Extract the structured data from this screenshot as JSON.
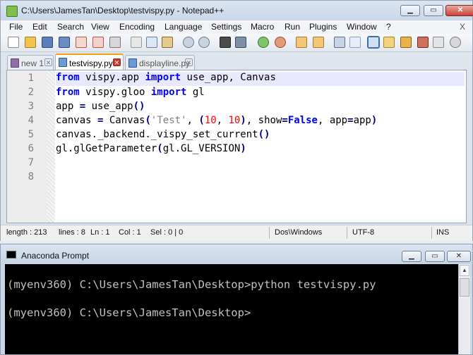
{
  "npp": {
    "title": "C:\\Users\\JamesTan\\Desktop\\testvispy.py - Notepad++",
    "menu": [
      "File",
      "Edit",
      "Search",
      "View",
      "Encoding",
      "Language",
      "Settings",
      "Macro",
      "Run",
      "Plugins",
      "Window",
      "?"
    ],
    "menu_close": "X",
    "tabs": [
      {
        "label": "new 1",
        "close": "✕"
      },
      {
        "label": "testvispy.py",
        "close": "✕"
      },
      {
        "label": "displayline.py",
        "close": "✕"
      }
    ],
    "line_numbers": [
      "1",
      "2",
      "3",
      "4",
      "5",
      "6",
      "7",
      "8"
    ],
    "code": {
      "l1": {
        "kw1": "from",
        "mod": " vispy.app ",
        "kw2": "import",
        "rest": " use_app, Canvas"
      },
      "l2": {
        "kw1": "from",
        "mod": " vispy.gloo ",
        "kw2": "import",
        "rest": " gl"
      },
      "l3": {
        "a": "app ",
        "eq": "=",
        "b": " use_app",
        "p": "()"
      },
      "l4": {
        "a": "canvas ",
        "eq": "=",
        "b": " Canvas",
        "p1": "(",
        "s": "'Test'",
        "c1": ", ",
        "p2": "(",
        "n1": "10",
        "c2": ", ",
        "n2": "10",
        "p3": ")",
        "c3": ", show",
        "eq2": "=",
        "f": "False",
        "c4": ", app",
        "eq3": "=",
        "d": "app",
        "p4": ")"
      },
      "l5": {
        "a": "canvas._backend._vispy_set_current",
        "p": "()"
      },
      "l6": {
        "a": "gl.glGetParameter",
        "p1": "(",
        "b": "gl.GL_VERSION",
        "p2": ")"
      }
    },
    "status": {
      "length": "length : 213",
      "lines": "lines : 8",
      "ln": "Ln : 1",
      "col": "Col : 1",
      "sel": "Sel : 0 | 0",
      "eol": "Dos\\Windows",
      "encoding": "UTF-8",
      "mode": "INS"
    }
  },
  "conda": {
    "title": "Anaconda Prompt",
    "lines": [
      "(myenv360) C:\\Users\\JamesTan\\Desktop>python testvispy.py",
      "(myenv360) C:\\Users\\JamesTan\\Desktop>"
    ]
  },
  "icons": {
    "titlebar": [
      "notepadpp-app-icon",
      "minimize-icon",
      "maximize-icon",
      "close-icon"
    ],
    "toolbar": [
      "new-file-icon",
      "open-file-icon",
      "save-icon",
      "save-all-icon",
      "close-icon",
      "close-all-icon",
      "print-icon",
      "cut-icon",
      "copy-icon",
      "paste-icon",
      "undo-icon",
      "redo-icon",
      "find-icon",
      "replace-icon",
      "zoom-in-icon",
      "zoom-out-icon",
      "sync-vertical-icon",
      "sync-horizontal-icon",
      "word-wrap-icon",
      "show-all-chars-icon",
      "indent-guide-icon",
      "doc-map-icon",
      "function-list-icon",
      "folder-workspace-icon",
      "monitoring-icon",
      "record-macro-icon"
    ]
  }
}
